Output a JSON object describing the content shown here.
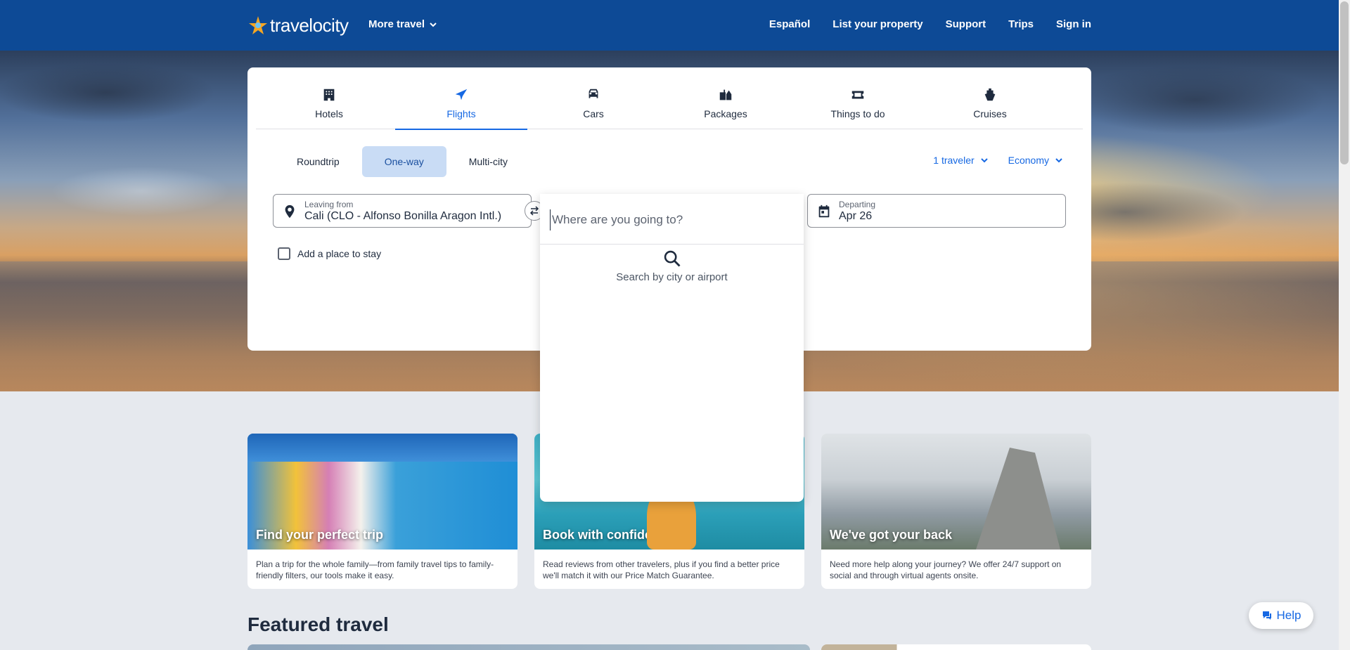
{
  "header": {
    "logo": "travelocity",
    "more_travel": "More travel",
    "nav": [
      "Español",
      "List your property",
      "Support",
      "Trips",
      "Sign in"
    ]
  },
  "tabs": [
    {
      "label": "Hotels",
      "icon": "hotel-icon"
    },
    {
      "label": "Flights",
      "icon": "plane-icon",
      "active": true
    },
    {
      "label": "Cars",
      "icon": "car-icon"
    },
    {
      "label": "Packages",
      "icon": "packages-icon"
    },
    {
      "label": "Things to do",
      "icon": "ticket-icon"
    },
    {
      "label": "Cruises",
      "icon": "cruise-icon"
    }
  ],
  "trip_types": [
    {
      "label": "Roundtrip"
    },
    {
      "label": "One-way",
      "active": true
    },
    {
      "label": "Multi-city"
    }
  ],
  "travelers": "1 traveler",
  "cabin": "Economy",
  "leaving": {
    "label": "Leaving from",
    "value": "Cali (CLO - Alfonso Bonilla Aragon Intl.)"
  },
  "departing": {
    "label": "Departing",
    "value": "Apr 26"
  },
  "add_stay": "Add a place to stay",
  "dropdown": {
    "placeholder": "Where are you going to?",
    "hint": "Search by city or airport"
  },
  "features": [
    {
      "title": "Find your perfect trip",
      "desc": "Plan a trip for the whole family—from family travel tips to family-friendly filters, our tools make it easy."
    },
    {
      "title": "Book with confidence",
      "desc": "Read reviews from other travelers, plus if you find a better price we'll match it with our Price Match Guarantee."
    },
    {
      "title": "We've got your back",
      "desc": "Need more help along your journey? We offer 24/7 support on social and through virtual agents onsite."
    }
  ],
  "featured_title": "Featured travel",
  "help_label": "Help",
  "colors": {
    "brand": "#0d4a96",
    "accent": "#1668e3",
    "active_trip_bg": "#c9dcf5"
  }
}
